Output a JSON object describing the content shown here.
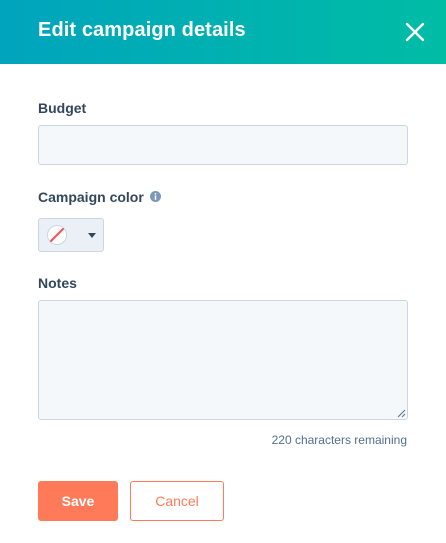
{
  "header": {
    "title": "Edit campaign details",
    "close_icon": "close-icon"
  },
  "form": {
    "budget": {
      "label": "Budget",
      "value": ""
    },
    "campaign_color": {
      "label": "Campaign color",
      "info_icon": "info-icon",
      "selected_color": "none",
      "dropdown_icon": "caret-down-icon"
    },
    "notes": {
      "label": "Notes",
      "value": "",
      "chars_remaining": "220 characters remaining"
    }
  },
  "actions": {
    "save_label": "Save",
    "cancel_label": "Cancel"
  },
  "colors": {
    "header_gradient_start": "#00a4bd",
    "header_gradient_end": "#00bda5",
    "primary_button": "#ff7a59",
    "text": "#33475b",
    "input_background": "#f5f8fa",
    "input_border": "#cbd6e2",
    "no_color_slash": "#f2545b"
  }
}
